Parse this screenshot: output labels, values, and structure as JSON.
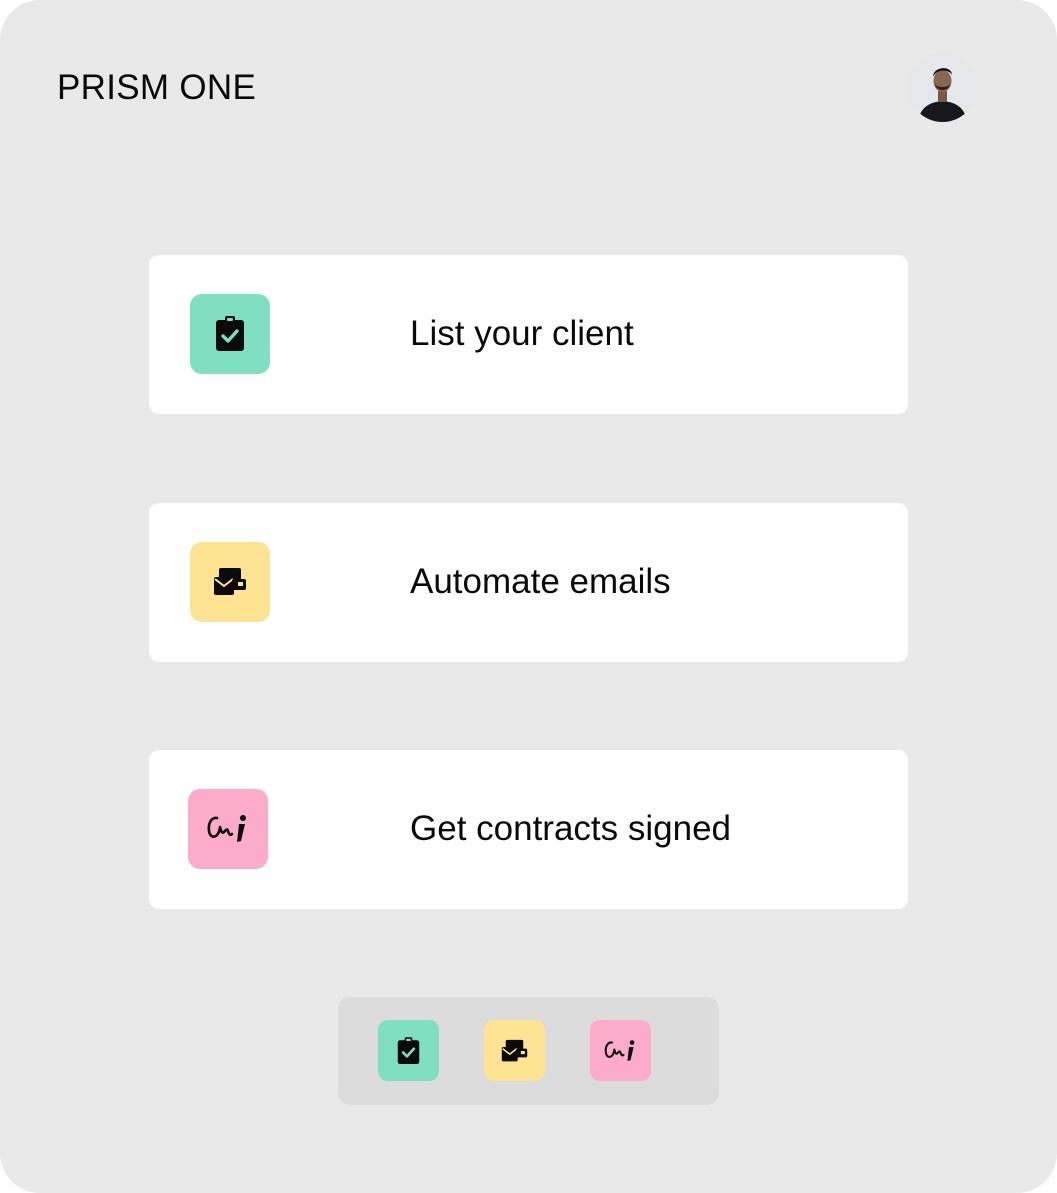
{
  "header": {
    "brand": "PRISM ONE",
    "avatar_icon": "user-avatar"
  },
  "colors": {
    "background": "#e9e9e9",
    "card": "#ffffff",
    "green_tile": "#80dfc0",
    "yellow_tile": "#fee393",
    "pink_tile": "#fdabcb",
    "dock": "#dcdcdc"
  },
  "steps": [
    {
      "label": "List your client",
      "icon": "clipboard-check-icon"
    },
    {
      "label": "Automate emails",
      "icon": "mail-stack-icon"
    },
    {
      "label": "Get contracts signed",
      "icon": "signature-icon"
    }
  ],
  "dock": {
    "items": [
      {
        "icon": "clipboard-check-icon"
      },
      {
        "icon": "mail-stack-icon"
      },
      {
        "icon": "signature-icon"
      }
    ]
  }
}
